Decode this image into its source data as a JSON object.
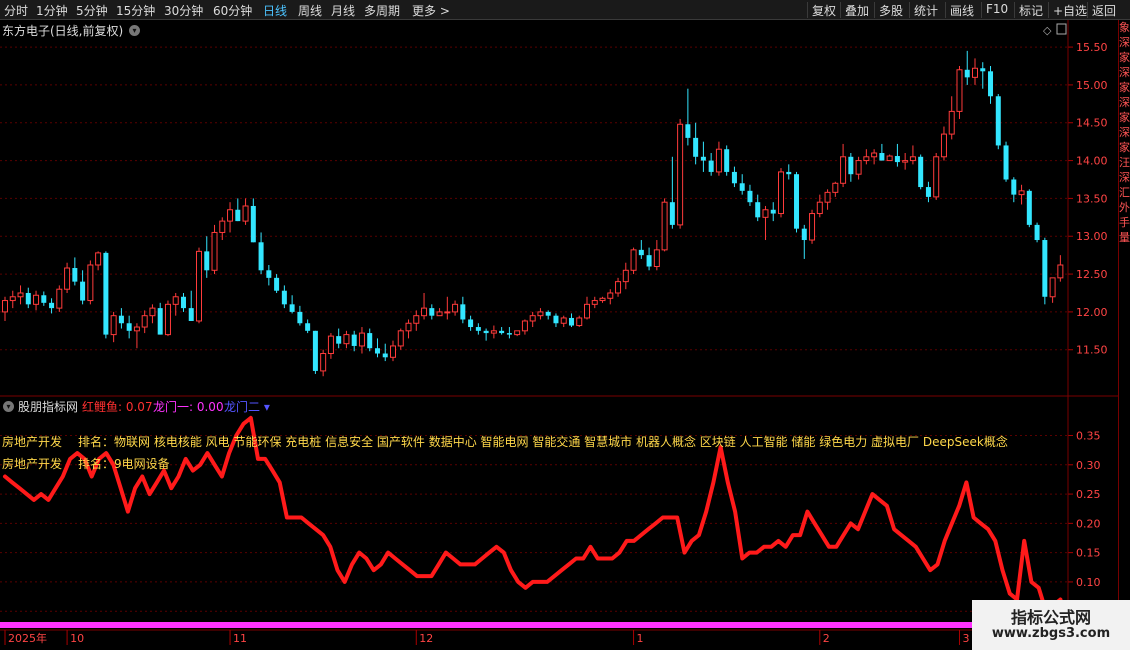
{
  "toolbar": {
    "left_items": [
      "分时",
      "1分钟",
      "5分钟",
      "15分钟",
      "30分钟",
      "60分钟",
      "日线",
      "周线",
      "月线",
      "多周期",
      "更多 >"
    ],
    "active_index": 6,
    "right_items": [
      "复权",
      "叠加",
      "多股",
      "统计",
      "画线",
      "F10",
      "标记",
      "+自选",
      "返回"
    ]
  },
  "stock": {
    "title": "东方电子(日线,前复权)"
  },
  "indicator": {
    "name": "股朋指标网",
    "label1": "红鲤鱼: 0.07",
    "label2": "龙门一: 0.00",
    "label3": "龙门二 ▾",
    "color1": "#ff3030",
    "color2": "#ff33ff",
    "color3": "#5555ff"
  },
  "annotations": {
    "line1_prefix": "房地产开发",
    "line1_text": "排名：物联网 核电核能 风电 节能环保 充电桩 信息安全 国产软件 数据中心 智能电网 智能交通 智慧城市 机器人概念 区块链 人工智能 储能 绿色电力 虚拟电厂 DeepSeek概念",
    "line2_prefix": "房地产开发",
    "line2_text": "排名：9电网设备"
  },
  "right_strip": [
    "象",
    "深",
    "家",
    "深",
    "家",
    "深",
    "家",
    "深",
    "家",
    "汪",
    "深",
    "汇",
    "外",
    "手",
    "量"
  ],
  "watermark": {
    "line1": "指标公式网",
    "line2": "www.zbgs3.com"
  },
  "time_axis": [
    {
      "label": "2025年",
      "index": 0
    },
    {
      "label": "10",
      "index": 8
    },
    {
      "label": "11",
      "index": 29
    },
    {
      "label": "12",
      "index": 53
    },
    {
      "label": "1",
      "index": 81
    },
    {
      "label": "2",
      "index": 105
    },
    {
      "label": "3",
      "index": 123
    }
  ],
  "chart_data": [
    {
      "type": "candlestick",
      "title": "东方电子(日线,前复权)",
      "ylim": [
        11.1,
        15.62
      ],
      "y_ticks": [
        11.5,
        12.0,
        12.5,
        13.0,
        13.5,
        14.0,
        14.5,
        15.0,
        15.5
      ],
      "y_tick_labels": [
        "11.50",
        "12.00",
        "12.50",
        "13.00",
        "13.50",
        "14.00",
        "14.50",
        "15.00",
        "15.50"
      ],
      "up_color": "#ff3b3b",
      "down_color": "#33e6ff",
      "grid": true,
      "ohlc": [
        [
          12.0,
          12.2,
          11.88,
          12.15
        ],
        [
          12.15,
          12.28,
          12.05,
          12.2
        ],
        [
          12.2,
          12.35,
          12.1,
          12.25
        ],
        [
          12.25,
          12.32,
          12.05,
          12.1
        ],
        [
          12.1,
          12.28,
          12.02,
          12.22
        ],
        [
          12.22,
          12.27,
          12.08,
          12.12
        ],
        [
          12.12,
          12.18,
          11.98,
          12.05
        ],
        [
          12.05,
          12.35,
          12.0,
          12.3
        ],
        [
          12.3,
          12.65,
          12.25,
          12.58
        ],
        [
          12.58,
          12.72,
          12.35,
          12.4
        ],
        [
          12.4,
          12.55,
          12.1,
          12.15
        ],
        [
          12.15,
          12.68,
          12.1,
          12.62
        ],
        [
          12.62,
          12.8,
          12.55,
          12.78
        ],
        [
          12.78,
          12.8,
          11.65,
          11.7
        ],
        [
          11.7,
          12.0,
          11.6,
          11.95
        ],
        [
          11.95,
          12.05,
          11.78,
          11.85
        ],
        [
          11.85,
          11.95,
          11.65,
          11.75
        ],
        [
          11.75,
          11.85,
          11.52,
          11.8
        ],
        [
          11.8,
          12.02,
          11.72,
          11.95
        ],
        [
          11.95,
          12.1,
          11.85,
          12.05
        ],
        [
          12.05,
          12.12,
          11.7,
          11.7
        ],
        [
          11.7,
          12.15,
          11.68,
          12.1
        ],
        [
          12.1,
          12.25,
          11.95,
          12.2
        ],
        [
          12.2,
          12.25,
          12.0,
          12.05
        ],
        [
          12.05,
          12.28,
          11.88,
          11.88
        ],
        [
          11.88,
          12.85,
          11.85,
          12.8
        ],
        [
          12.8,
          13.0,
          12.45,
          12.55
        ],
        [
          12.55,
          13.15,
          12.5,
          13.05
        ],
        [
          13.05,
          13.25,
          12.95,
          13.2
        ],
        [
          13.2,
          13.45,
          13.05,
          13.35
        ],
        [
          13.35,
          13.5,
          13.2,
          13.2
        ],
        [
          13.2,
          13.5,
          13.15,
          13.4
        ],
        [
          13.4,
          13.5,
          12.92,
          12.92
        ],
        [
          12.92,
          13.05,
          12.5,
          12.55
        ],
        [
          12.55,
          12.62,
          12.35,
          12.45
        ],
        [
          12.45,
          12.5,
          12.25,
          12.28
        ],
        [
          12.28,
          12.35,
          12.05,
          12.1
        ],
        [
          12.1,
          12.22,
          11.98,
          12.0
        ],
        [
          12.0,
          12.08,
          11.82,
          11.85
        ],
        [
          11.85,
          11.9,
          11.72,
          11.75
        ],
        [
          11.75,
          11.75,
          11.18,
          11.22
        ],
        [
          11.22,
          11.5,
          11.15,
          11.45
        ],
        [
          11.45,
          11.72,
          11.38,
          11.68
        ],
        [
          11.68,
          11.78,
          11.52,
          11.58
        ],
        [
          11.58,
          11.75,
          11.52,
          11.7
        ],
        [
          11.7,
          11.75,
          11.48,
          11.55
        ],
        [
          11.55,
          11.8,
          11.45,
          11.72
        ],
        [
          11.72,
          11.78,
          11.48,
          11.52
        ],
        [
          11.52,
          11.65,
          11.4,
          11.45
        ],
        [
          11.45,
          11.58,
          11.35,
          11.4
        ],
        [
          11.4,
          11.62,
          11.35,
          11.55
        ],
        [
          11.55,
          11.78,
          11.5,
          11.75
        ],
        [
          11.75,
          11.9,
          11.65,
          11.85
        ],
        [
          11.85,
          12.02,
          11.75,
          11.95
        ],
        [
          11.95,
          12.25,
          11.9,
          12.05
        ],
        [
          12.05,
          12.1,
          11.9,
          11.95
        ],
        [
          11.95,
          12.05,
          11.98,
          12.0
        ],
        [
          12.0,
          12.2,
          11.9,
          12.0
        ],
        [
          12.0,
          12.15,
          11.95,
          12.1
        ],
        [
          12.1,
          12.2,
          11.85,
          11.9
        ],
        [
          11.9,
          11.95,
          11.75,
          11.8
        ],
        [
          11.8,
          11.85,
          11.7,
          11.75
        ],
        [
          11.75,
          11.78,
          11.62,
          11.72
        ],
        [
          11.72,
          11.82,
          11.65,
          11.75
        ],
        [
          11.75,
          11.8,
          11.7,
          11.72
        ],
        [
          11.72,
          11.8,
          11.65,
          11.7
        ],
        [
          11.7,
          11.75,
          11.68,
          11.75
        ],
        [
          11.75,
          11.9,
          11.7,
          11.88
        ],
        [
          11.88,
          12.0,
          11.8,
          11.95
        ],
        [
          11.95,
          12.05,
          11.9,
          12.0
        ],
        [
          12.0,
          12.02,
          11.9,
          11.95
        ],
        [
          11.95,
          11.98,
          11.8,
          11.85
        ],
        [
          11.85,
          11.95,
          11.8,
          11.92
        ],
        [
          11.92,
          11.98,
          11.8,
          11.82
        ],
        [
          11.82,
          11.95,
          11.8,
          11.92
        ],
        [
          11.92,
          12.2,
          11.9,
          12.1
        ],
        [
          12.1,
          12.2,
          12.05,
          12.15
        ],
        [
          12.15,
          12.2,
          12.12,
          12.18
        ],
        [
          12.18,
          12.3,
          12.1,
          12.25
        ],
        [
          12.25,
          12.45,
          12.2,
          12.4
        ],
        [
          12.4,
          12.65,
          12.3,
          12.55
        ],
        [
          12.55,
          12.85,
          12.5,
          12.82
        ],
        [
          12.82,
          12.95,
          12.7,
          12.75
        ],
        [
          12.75,
          12.85,
          12.55,
          12.6
        ],
        [
          12.6,
          12.95,
          12.55,
          12.82
        ],
        [
          12.82,
          13.5,
          12.8,
          13.45
        ],
        [
          13.45,
          14.05,
          13.1,
          13.15
        ],
        [
          13.15,
          14.55,
          13.1,
          14.48
        ],
        [
          14.48,
          14.95,
          14.2,
          14.3
        ],
        [
          14.3,
          14.5,
          13.95,
          14.05
        ],
        [
          14.05,
          14.25,
          13.85,
          14.0
        ],
        [
          14.0,
          14.1,
          13.8,
          13.85
        ],
        [
          13.85,
          14.25,
          13.8,
          14.15
        ],
        [
          14.15,
          14.2,
          13.8,
          13.85
        ],
        [
          13.85,
          13.92,
          13.65,
          13.7
        ],
        [
          13.7,
          13.82,
          13.55,
          13.6
        ],
        [
          13.6,
          13.68,
          13.4,
          13.45
        ],
        [
          13.45,
          13.55,
          13.2,
          13.25
        ],
        [
          13.25,
          13.4,
          12.95,
          13.35
        ],
        [
          13.35,
          13.45,
          13.2,
          13.3
        ],
        [
          13.3,
          13.9,
          13.25,
          13.85
        ],
        [
          13.85,
          13.95,
          13.75,
          13.82
        ],
        [
          13.82,
          13.85,
          13.05,
          13.1
        ],
        [
          13.1,
          13.15,
          12.7,
          12.95
        ],
        [
          12.95,
          13.35,
          12.9,
          13.3
        ],
        [
          13.3,
          13.55,
          13.25,
          13.45
        ],
        [
          13.45,
          13.62,
          13.35,
          13.58
        ],
        [
          13.58,
          13.72,
          13.52,
          13.7
        ],
        [
          13.7,
          14.22,
          13.65,
          14.05
        ],
        [
          14.05,
          14.1,
          13.72,
          13.82
        ],
        [
          13.82,
          14.05,
          13.75,
          14.0
        ],
        [
          14.0,
          14.15,
          13.95,
          14.05
        ],
        [
          14.05,
          14.15,
          13.95,
          14.1
        ],
        [
          14.1,
          14.22,
          14.0,
          14.0
        ],
        [
          14.0,
          14.08,
          14.0,
          14.06
        ],
        [
          14.06,
          14.22,
          13.92,
          13.98
        ],
        [
          13.98,
          14.1,
          13.88,
          14.0
        ],
        [
          14.0,
          14.2,
          13.95,
          14.05
        ],
        [
          14.05,
          14.08,
          13.62,
          13.65
        ],
        [
          13.65,
          13.72,
          13.45,
          13.52
        ],
        [
          13.52,
          14.1,
          13.48,
          14.05
        ],
        [
          14.05,
          14.45,
          14.0,
          14.35
        ],
        [
          14.35,
          14.85,
          14.28,
          14.65
        ],
        [
          14.65,
          15.25,
          14.55,
          15.2
        ],
        [
          15.2,
          15.45,
          15.0,
          15.1
        ],
        [
          15.1,
          15.35,
          15.0,
          15.22
        ],
        [
          15.22,
          15.3,
          14.95,
          15.18
        ],
        [
          15.18,
          15.25,
          14.75,
          14.85
        ],
        [
          14.85,
          14.88,
          14.15,
          14.2
        ],
        [
          14.2,
          14.25,
          13.72,
          13.75
        ],
        [
          13.75,
          13.78,
          13.45,
          13.55
        ],
        [
          13.55,
          13.68,
          13.42,
          13.6
        ],
        [
          13.6,
          13.62,
          13.12,
          13.15
        ],
        [
          13.15,
          13.18,
          12.92,
          12.95
        ],
        [
          12.95,
          12.98,
          12.1,
          12.2
        ],
        [
          12.2,
          12.45,
          12.12,
          12.45
        ],
        [
          12.45,
          12.75,
          12.4,
          12.62
        ]
      ]
    },
    {
      "type": "line",
      "title": "股朋指标网",
      "ylim": [
        0.035,
        0.385
      ],
      "y_ticks": [
        0.05,
        0.1,
        0.15,
        0.2,
        0.25,
        0.3,
        0.35
      ],
      "y_tick_labels": [
        "0.05",
        "0.10",
        "0.15",
        "0.20",
        "0.25",
        "0.30",
        "0.35"
      ],
      "series": [
        {
          "name": "红鲤鱼",
          "color": "#ff1a1a",
          "values": [
            0.28,
            0.27,
            0.26,
            0.25,
            0.24,
            0.25,
            0.24,
            0.26,
            0.28,
            0.31,
            0.32,
            0.31,
            0.28,
            0.31,
            0.32,
            0.3,
            0.26,
            0.22,
            0.26,
            0.28,
            0.25,
            0.27,
            0.29,
            0.26,
            0.28,
            0.31,
            0.29,
            0.3,
            0.32,
            0.3,
            0.28,
            0.32,
            0.35,
            0.37,
            0.38,
            0.31,
            0.31,
            0.29,
            0.27,
            0.21,
            0.21,
            0.21,
            0.2,
            0.19,
            0.18,
            0.16,
            0.12,
            0.1,
            0.13,
            0.15,
            0.14,
            0.12,
            0.13,
            0.15,
            0.14,
            0.13,
            0.12,
            0.11,
            0.11,
            0.11,
            0.13,
            0.15,
            0.14,
            0.13,
            0.13,
            0.13,
            0.14,
            0.15,
            0.16,
            0.15,
            0.12,
            0.1,
            0.09,
            0.1,
            0.1,
            0.1,
            0.11,
            0.12,
            0.13,
            0.14,
            0.14,
            0.16,
            0.14,
            0.14,
            0.14,
            0.15,
            0.17,
            0.17,
            0.18,
            0.19,
            0.2,
            0.21,
            0.21,
            0.21,
            0.15,
            0.17,
            0.18,
            0.22,
            0.27,
            0.33,
            0.27,
            0.22,
            0.14,
            0.15,
            0.15,
            0.16,
            0.16,
            0.17,
            0.16,
            0.18,
            0.18,
            0.22,
            0.2,
            0.18,
            0.16,
            0.16,
            0.18,
            0.2,
            0.19,
            0.22,
            0.25,
            0.24,
            0.23,
            0.19,
            0.18,
            0.17,
            0.16,
            0.14,
            0.12,
            0.13,
            0.17,
            0.2,
            0.23,
            0.27,
            0.21,
            0.2,
            0.19,
            0.17,
            0.12,
            0.08,
            0.07,
            0.17,
            0.1,
            0.09,
            0.05,
            0.06,
            0.07
          ]
        }
      ]
    }
  ]
}
